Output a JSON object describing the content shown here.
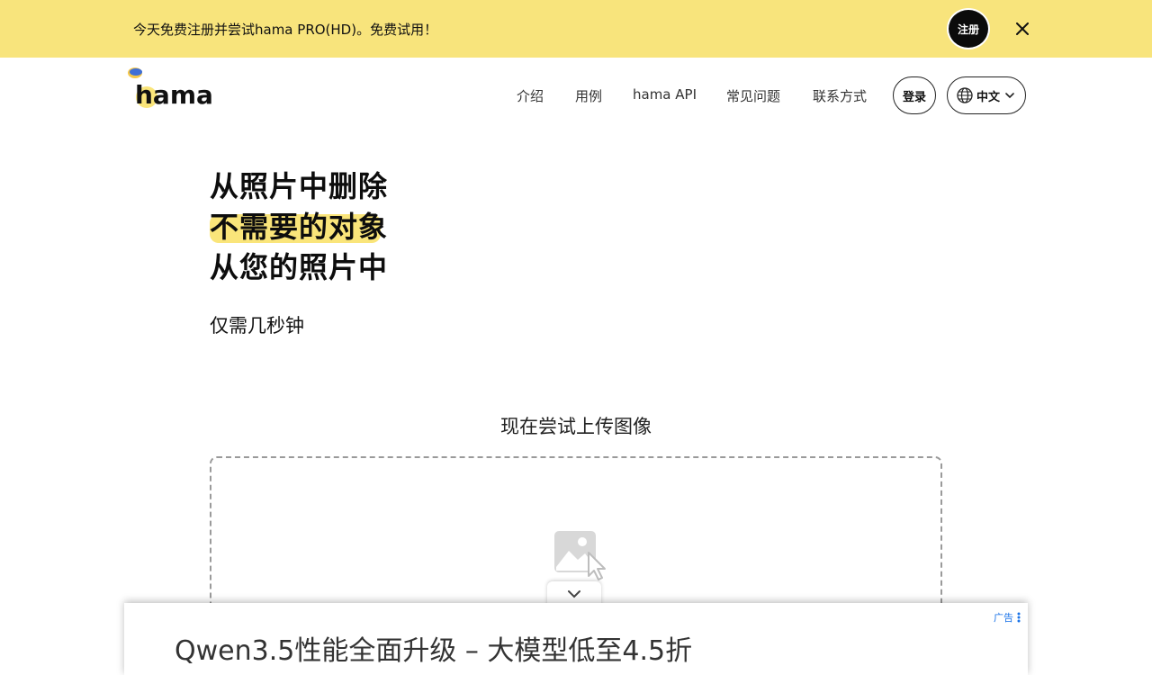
{
  "promo": {
    "text": "今天免费注册并尝试hama PRO(HD)。免费试用！",
    "signup_label": "注册"
  },
  "header": {
    "logo_text": "hama",
    "nav": [
      "介绍",
      "用例",
      "hama API",
      "常见问题",
      "联系方式"
    ],
    "login_label": "登录",
    "language_label": "中文"
  },
  "hero": {
    "lines": [
      "从照片中删除",
      "不需要的对象",
      "从您的照片中"
    ],
    "subtitle": "仅需几秒钟"
  },
  "upload": {
    "title": "现在尝试上传图像"
  },
  "ad": {
    "label": "广告",
    "headline": "Qwen3.5性能全面升级 – 大模型低至4.5折"
  },
  "colors": {
    "banner": "#f8e47c",
    "highlight": "#fae57a",
    "ad_link": "#1a73e8"
  }
}
